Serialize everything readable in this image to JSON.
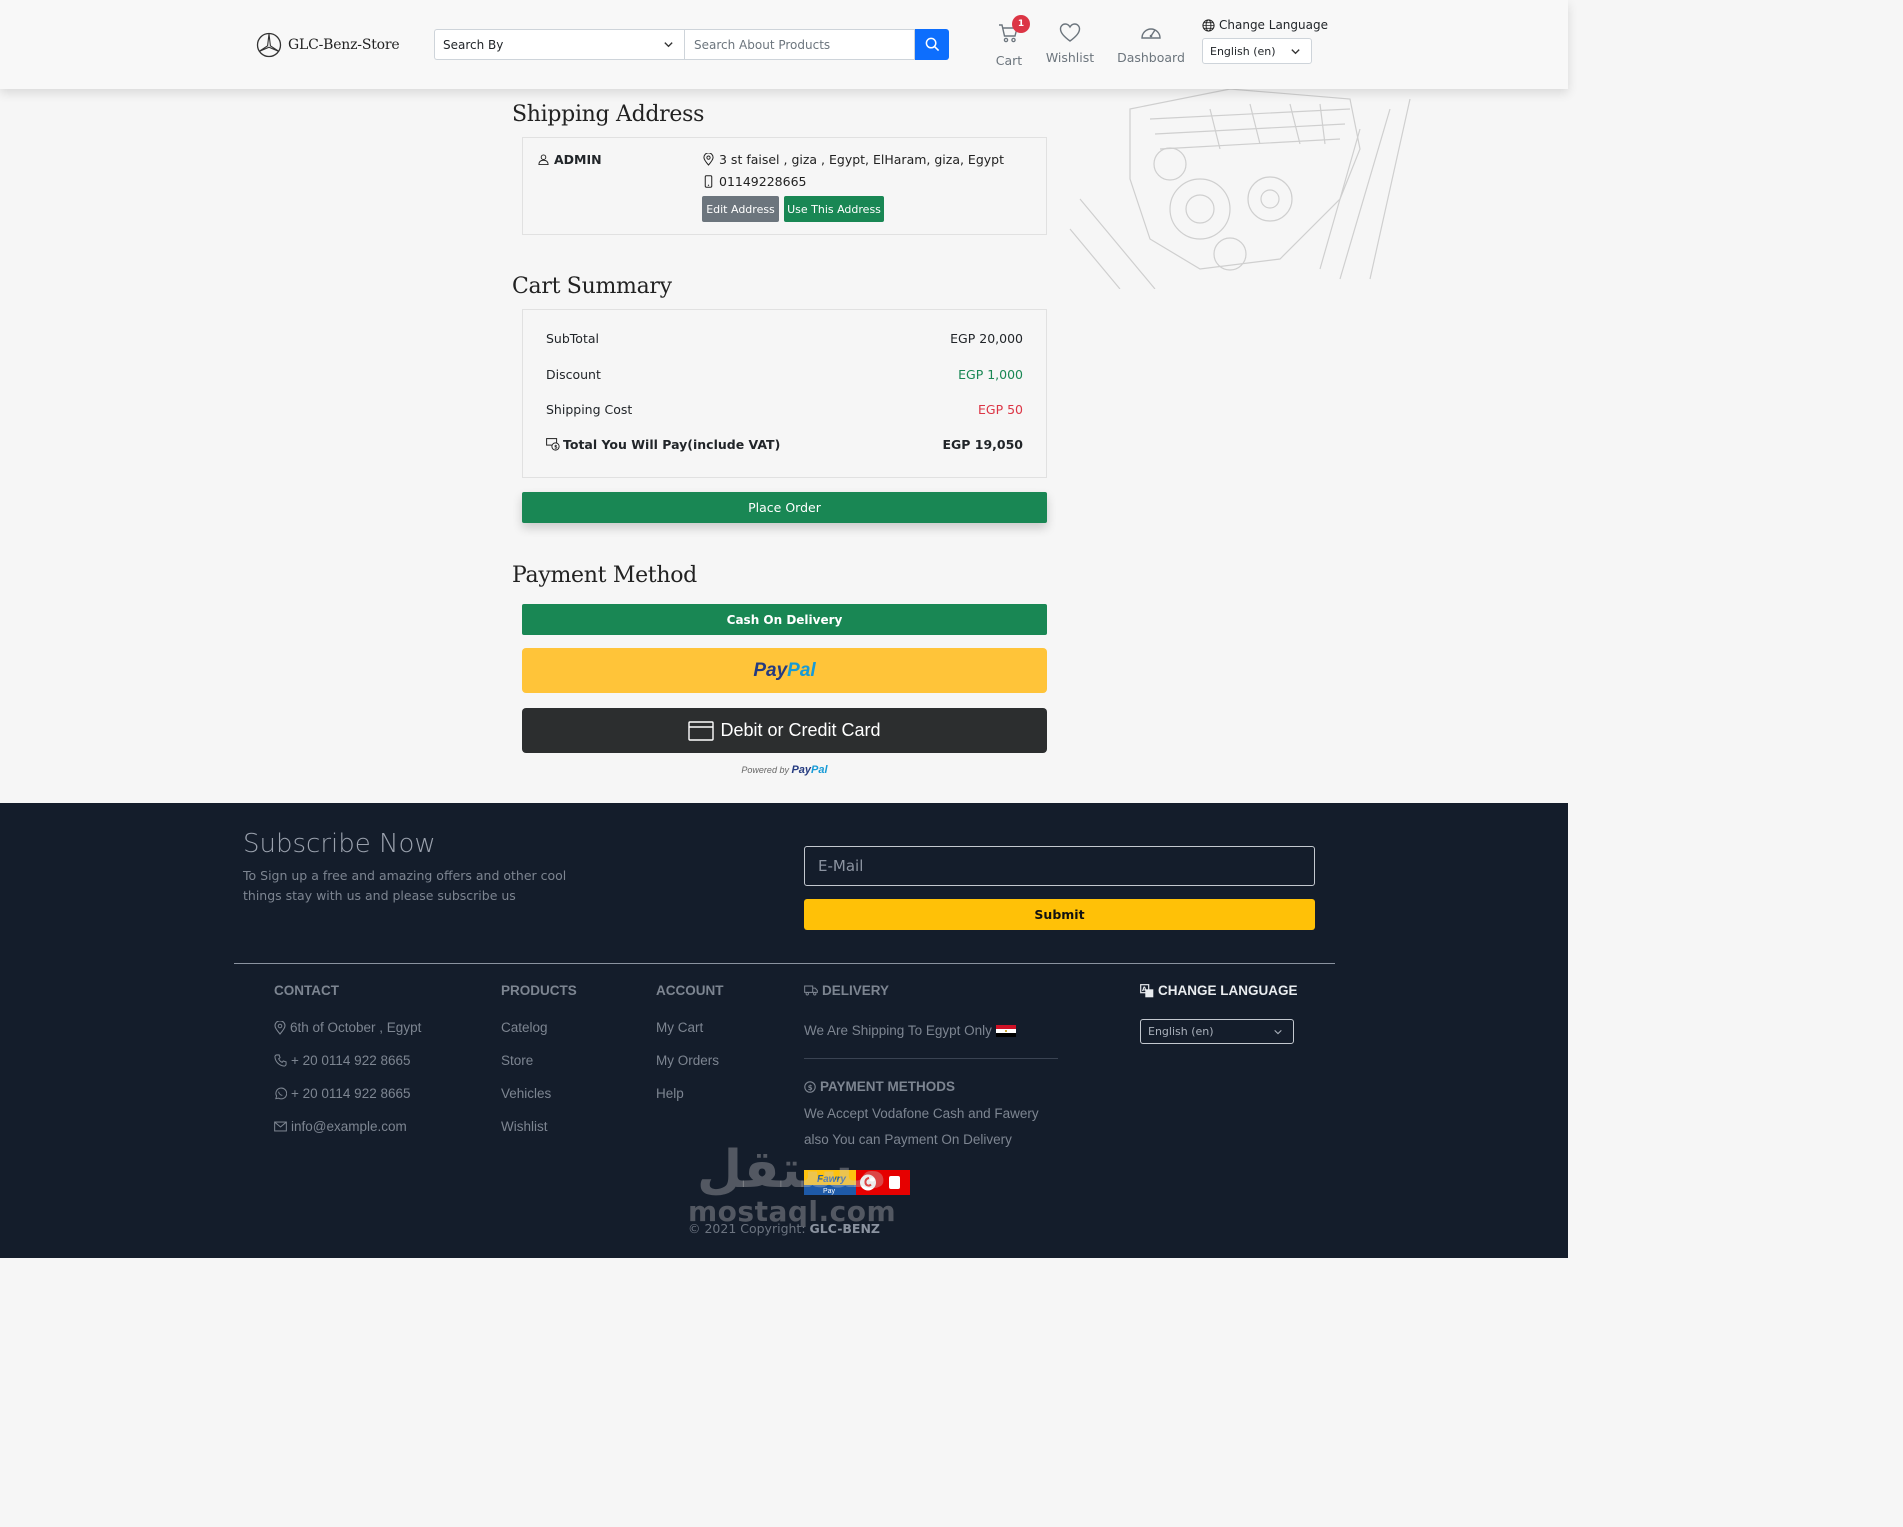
{
  "header": {
    "brand": "GLC-Benz-Store",
    "search_by": "Search By",
    "search_placeholder": "Search About Products",
    "cart_label": "Cart",
    "cart_count": "1",
    "wishlist_label": "Wishlist",
    "dashboard_label": "Dashboard",
    "change_language": "Change Language",
    "language_selected": "English (en)"
  },
  "shipping": {
    "title": "Shipping Address",
    "name": "ADMIN",
    "address": "3 st faisel , giza , Egypt, ElHaram, giza, Egypt",
    "phone": "01149228665",
    "edit_label": "Edit Address",
    "use_label": "Use This Address"
  },
  "summary": {
    "title": "Cart Summary",
    "subtotal_label": "SubTotal",
    "subtotal_value": "EGP 20,000",
    "discount_label": "Discount",
    "discount_value": "EGP 1,000",
    "shipping_label": "Shipping Cost",
    "shipping_value": "EGP 50",
    "total_label": "Total You Will Pay(include VAT)",
    "total_value": "EGP 19,050",
    "place_order": "Place Order"
  },
  "payment": {
    "title": "Payment Method",
    "cod": "Cash On Delivery",
    "paypal_pay": "Pay",
    "paypal_pal": "Pal",
    "card": "Debit or Credit Card",
    "powered_by": "Powered by"
  },
  "footer": {
    "subscribe_title": "Subscribe Now",
    "subscribe_text": "To Sign up a free and amazing offers and other cool things stay with us and please subscribe us",
    "email_placeholder": "E-Mail",
    "submit": "Submit",
    "contact": {
      "heading": "CONTACT",
      "location": "6th of October , Egypt",
      "phone": "+ 20 0114 922 8665",
      "whatsapp": "+ 20 0114 922 8665",
      "email": "info@example.com"
    },
    "products": {
      "heading": "PRODUCTS",
      "items": [
        "Catelog",
        "Store",
        "Vehicles",
        "Wishlist"
      ]
    },
    "account": {
      "heading": "ACCOUNT",
      "items": [
        "My Cart",
        "My Orders",
        "Help"
      ]
    },
    "delivery": {
      "heading": "DELIVERY",
      "text": "We Are Shipping To Egypt Only"
    },
    "payment_methods": {
      "heading": "PAYMENT METHODS",
      "line1": "We Accept Vodafone Cash and Fawery",
      "line2": "also You can Payment On Delivery"
    },
    "change_language": {
      "heading": "CHANGE LANGUAGE",
      "selected": "English (en)"
    },
    "fawry_logo": "Fawry",
    "fawry_sub": "Pay",
    "copyright_prefix": "© 2021 Copyright:",
    "copyright_brand": "GLC-BENZ",
    "watermark_ar": "مستقل",
    "watermark_en": "mostaql.com"
  },
  "colors": {
    "primary": "#0d6efd",
    "success": "#198754",
    "danger": "#dc3545",
    "warning": "#ffc107",
    "paypal_yellow": "#ffc439",
    "card_dark": "#2c2e2f",
    "footer_bg": "#141d2b"
  }
}
